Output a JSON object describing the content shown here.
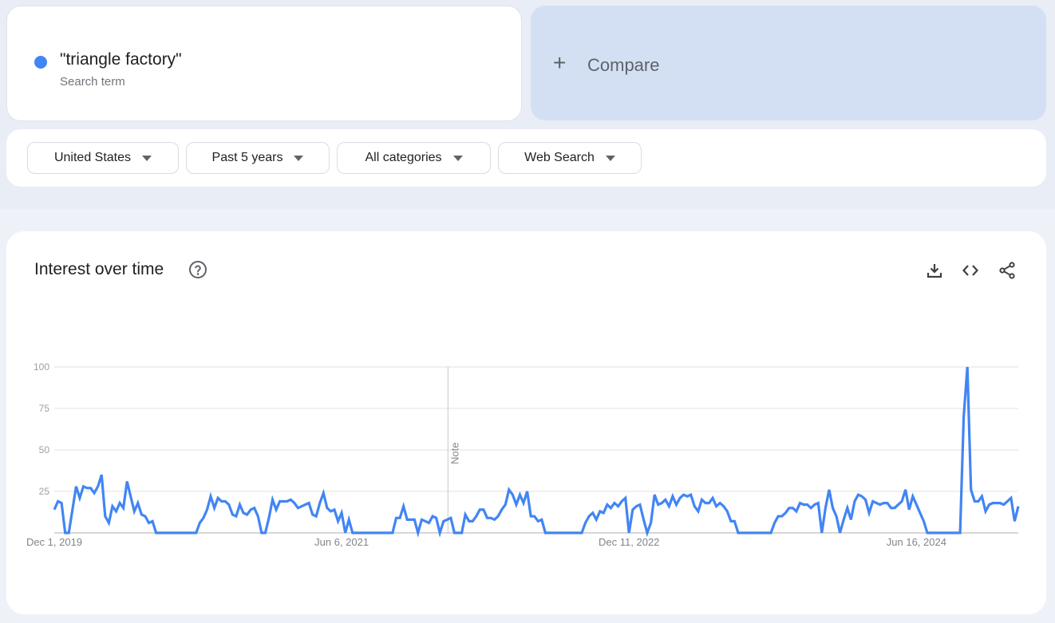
{
  "search_term": {
    "label": "\"triangle factory\"",
    "sublabel": "Search term",
    "color": "#4285f4"
  },
  "compare": {
    "icon": "plus-icon",
    "label": "Compare"
  },
  "filters": [
    {
      "label": "United States",
      "icon": "caret-down-icon"
    },
    {
      "label": "Past 5 years",
      "icon": "caret-down-icon"
    },
    {
      "label": "All categories",
      "icon": "caret-down-icon"
    },
    {
      "label": "Web Search",
      "icon": "caret-down-icon"
    }
  ],
  "chart_section": {
    "title": "Interest over time",
    "help_icon": "help-circle-icon",
    "actions": [
      {
        "name": "download",
        "icon": "download-icon"
      },
      {
        "name": "embed",
        "icon": "code-icon"
      },
      {
        "name": "share",
        "icon": "share-icon"
      }
    ]
  },
  "chart_data": {
    "type": "line",
    "title": "Interest over time",
    "xlabel": "",
    "ylabel": "",
    "ylim": [
      0,
      100
    ],
    "yticks": [
      25,
      50,
      75,
      100
    ],
    "xtick_labels": [
      "Dec 1, 2019",
      "Jun 6, 2021",
      "Dec 11, 2022",
      "Jun 16, 2024"
    ],
    "xtick_week_index": [
      0,
      79,
      158,
      237
    ],
    "grid": true,
    "legend": "none",
    "series_color": "#4285f4",
    "annotations": [
      {
        "label": "Note",
        "week_index": 108
      }
    ],
    "x_start": "Dec 1, 2019",
    "x_interval": "weekly",
    "series": [
      {
        "name": "\"triangle factory\"",
        "values": [
          14,
          19,
          18,
          0,
          0,
          14,
          28,
          21,
          28,
          27,
          27,
          24,
          28,
          35,
          10,
          6,
          16,
          13,
          18,
          15,
          31,
          22,
          13,
          18,
          11,
          10,
          6,
          7,
          0,
          0,
          0,
          0,
          0,
          0,
          0,
          0,
          0,
          0,
          0,
          0,
          6,
          9,
          14,
          22,
          15,
          21,
          19,
          19,
          17,
          11,
          10,
          17,
          12,
          11,
          14,
          15,
          10,
          0,
          0,
          9,
          20,
          14,
          19,
          19,
          19,
          20,
          18,
          15,
          16,
          17,
          18,
          11,
          10,
          18,
          24,
          15,
          13,
          14,
          7,
          12,
          0,
          8,
          0,
          0,
          0,
          0,
          0,
          0,
          0,
          0,
          0,
          0,
          0,
          0,
          9,
          9,
          16,
          8,
          8,
          8,
          0,
          8,
          7,
          6,
          10,
          9,
          0,
          7,
          8,
          9,
          0,
          0,
          0,
          11,
          7,
          7,
          10,
          14,
          14,
          9,
          9,
          8,
          10,
          14,
          17,
          26,
          23,
          17,
          23,
          18,
          25,
          10,
          10,
          7,
          8,
          0,
          0,
          0,
          0,
          0,
          0,
          0,
          0,
          0,
          0,
          0,
          6,
          10,
          12,
          8,
          13,
          12,
          17,
          15,
          18,
          16,
          19,
          21,
          0,
          14,
          16,
          17,
          8,
          0,
          6,
          23,
          17,
          18,
          20,
          16,
          22,
          17,
          21,
          23,
          22,
          23,
          16,
          13,
          20,
          18,
          18,
          21,
          16,
          18,
          16,
          13,
          7,
          7,
          0,
          0,
          0,
          0,
          0,
          0,
          0,
          0,
          0,
          0,
          6,
          10,
          10,
          12,
          15,
          15,
          13,
          18,
          17,
          17,
          15,
          17,
          18,
          0,
          15,
          26,
          15,
          10,
          0,
          8,
          15,
          8,
          19,
          23,
          22,
          20,
          12,
          19,
          18,
          17,
          18,
          18,
          15,
          15,
          17,
          19,
          26,
          14,
          22,
          17,
          12,
          7,
          0,
          0,
          0,
          0,
          0,
          0,
          0,
          0,
          0,
          0,
          70,
          100,
          26,
          19,
          19,
          22,
          13,
          17,
          18,
          18,
          18,
          17,
          19,
          21,
          7,
          16
        ]
      }
    ]
  }
}
